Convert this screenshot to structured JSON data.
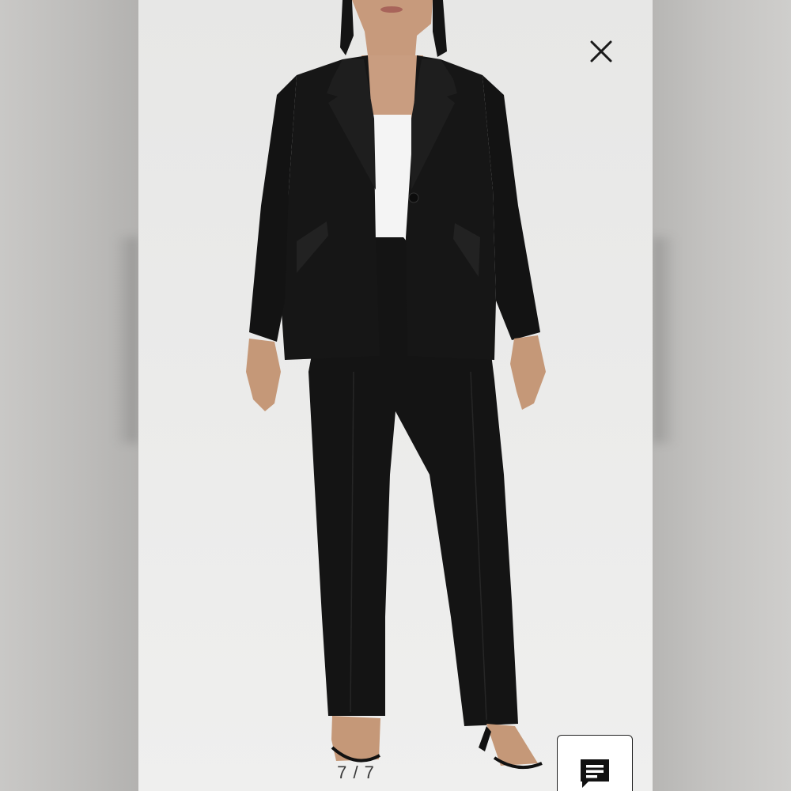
{
  "viewer": {
    "counter": "7 / 7",
    "close_icon": "close-icon",
    "chat_icon": "chat-icon"
  },
  "colors": {
    "suit": "#151515",
    "top": "#f4f4f4",
    "background": "#e8e8e7"
  }
}
